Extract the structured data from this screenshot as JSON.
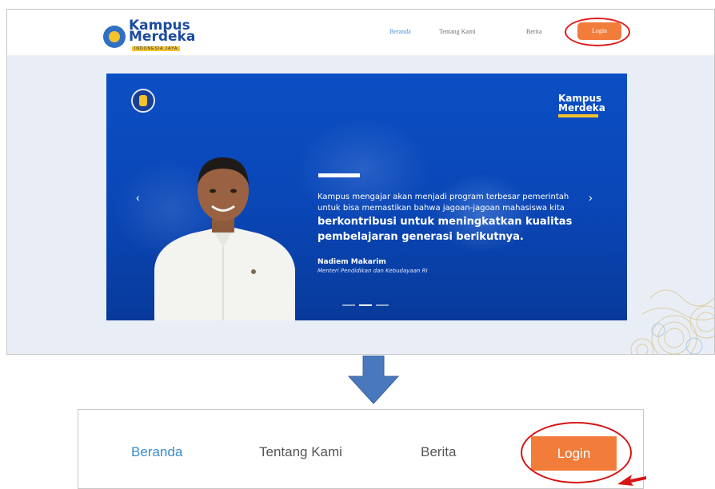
{
  "site": {
    "logo": {
      "line1": "Kampus",
      "line2": "Merdeka",
      "tagline": "INDONESIA JAYA"
    },
    "nav": [
      {
        "label": "Beranda",
        "active": true
      },
      {
        "label": "Tentang Kami",
        "active": false
      },
      {
        "label": "Berita",
        "active": false
      }
    ],
    "login_label": "Login"
  },
  "banner": {
    "logo_line1": "Kampus",
    "logo_line2": "Merdeka",
    "quote_normal": "Kampus mengajar akan menjadi program terbesar pemerintah untuk bisa memastikan bahwa jagoan-jagoan mahasiswa kita ",
    "quote_bold": "berkontribusi untuk meningkatkan kualitas pembelajaran generasi berikutnya.",
    "author": "Nadiem Makarim",
    "author_title": "Menteri Pendidikan dan Kebudayaan RI",
    "slides_total": 3,
    "slide_active": 2
  },
  "zoom": {
    "nav": [
      "Beranda",
      "Tentang Kami",
      "Berita"
    ],
    "login_label": "Login"
  },
  "colors": {
    "brand_blue": "#0b4fc4",
    "nav_active": "#3a8dcc",
    "login_orange": "#f27c3a",
    "highlight_red": "#e11b1b",
    "arrow_blue": "#4a78bd"
  }
}
